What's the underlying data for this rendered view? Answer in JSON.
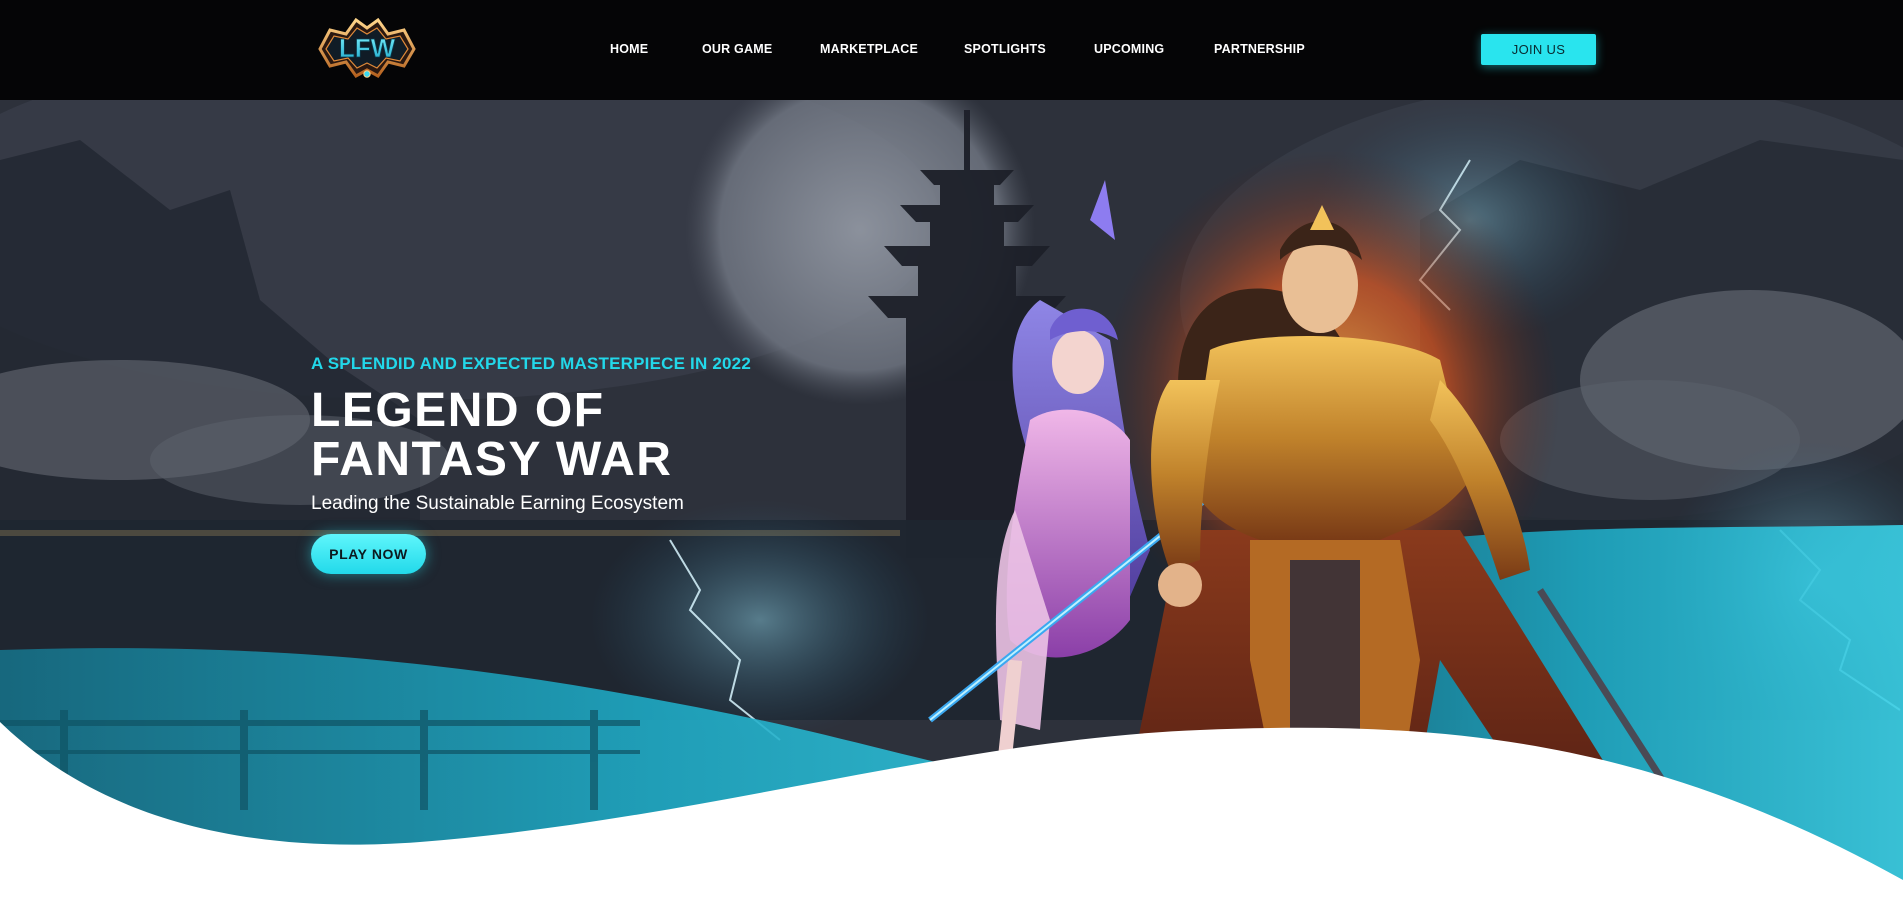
{
  "brand": {
    "logo_text": "LFW"
  },
  "nav": {
    "items": [
      {
        "label": "HOME"
      },
      {
        "label": "OUR GAME"
      },
      {
        "label": "MARKETPLACE"
      },
      {
        "label": "SPOTLIGHTS"
      },
      {
        "label": "UPCOMING"
      },
      {
        "label": "PARTNERSHIP"
      }
    ],
    "join_label": "JOIN US"
  },
  "hero": {
    "tagline": "A SPLENDID AND EXPECTED MASTERPIECE IN 2022",
    "title_line1": "LEGEND OF",
    "title_line2": "FANTASY WAR",
    "subtitle": "Leading the Sustainable Earning Ecosystem",
    "play_label": "PLAY NOW"
  },
  "colors": {
    "accent": "#29e4ee",
    "nav_background": "#050506",
    "wave_teal": "#1ea9c4",
    "page_background": "#ffffff"
  },
  "icons": {
    "logo": "lfw-logo-emblem"
  }
}
